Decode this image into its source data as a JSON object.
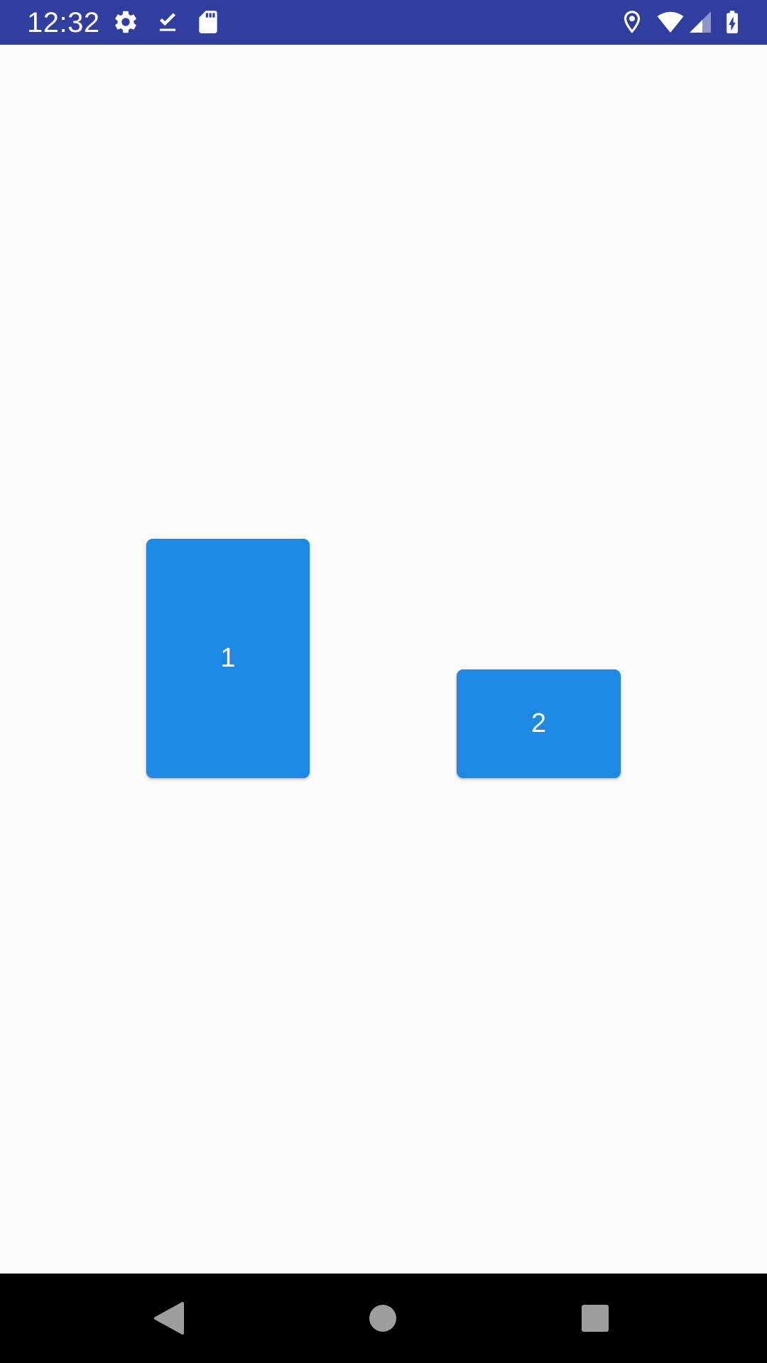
{
  "status_bar": {
    "time": "12:32",
    "background_color": "#303f9f",
    "left_icons": [
      "settings-icon",
      "download-done-icon",
      "sd-card-icon"
    ],
    "right_icons": [
      "location-icon",
      "wifi-icon",
      "signal-icon",
      "battery-charging-icon"
    ]
  },
  "content": {
    "background_color": "#fafafa",
    "cards": [
      {
        "label": "1",
        "color": "#1e88e5"
      },
      {
        "label": "2",
        "color": "#1e88e5"
      }
    ]
  },
  "nav_bar": {
    "buttons": [
      "back-icon",
      "home-icon",
      "recents-icon"
    ],
    "icon_color": "#9e9e9e"
  }
}
